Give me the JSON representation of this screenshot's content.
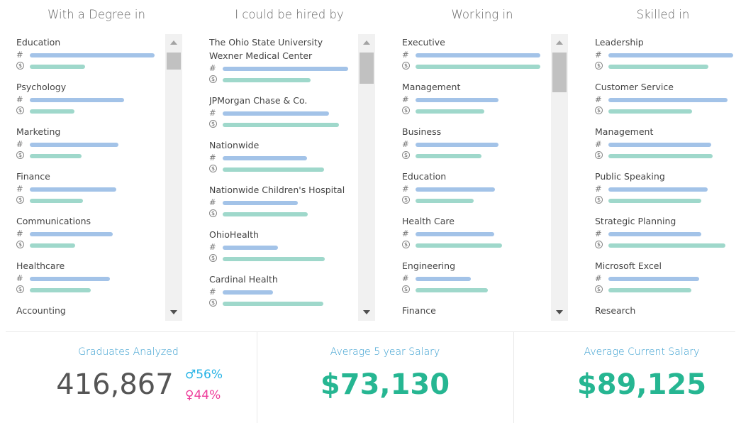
{
  "columns": [
    {
      "title": "With a Degree in",
      "items": [
        {
          "label": "Education"
        },
        {
          "label": "Psychology"
        },
        {
          "label": "Marketing"
        },
        {
          "label": "Finance"
        },
        {
          "label": "Communications"
        },
        {
          "label": "Healthcare"
        },
        {
          "label": "Accounting"
        }
      ]
    },
    {
      "title": "I could be hired by",
      "items": [
        {
          "label": "The Ohio State University",
          "label2": "Wexner Medical Center"
        },
        {
          "label": "JPMorgan Chase & Co."
        },
        {
          "label": "Nationwide"
        },
        {
          "label": "Nationwide Children's Hospital"
        },
        {
          "label": "OhioHealth"
        },
        {
          "label": "Cardinal Health"
        }
      ]
    },
    {
      "title": "Working in",
      "items": [
        {
          "label": "Executive"
        },
        {
          "label": "Management"
        },
        {
          "label": "Business"
        },
        {
          "label": "Education"
        },
        {
          "label": "Health Care"
        },
        {
          "label": "Engineering"
        },
        {
          "label": "Finance"
        }
      ]
    },
    {
      "title": "Skilled in",
      "items": [
        {
          "label": "Leadership"
        },
        {
          "label": "Customer Service"
        },
        {
          "label": "Management"
        },
        {
          "label": "Public Speaking"
        },
        {
          "label": "Strategic Planning"
        },
        {
          "label": "Microsoft Excel"
        },
        {
          "label": "Research"
        }
      ]
    }
  ],
  "metric_symbols": {
    "count": "#",
    "salary": "$"
  },
  "stats": {
    "graduates": {
      "label": "Graduates Analyzed",
      "value": "416,867",
      "male": "♂56%",
      "female": "♀44%"
    },
    "five_year": {
      "label": "Average 5 year Salary",
      "value": "$73,130"
    },
    "current": {
      "label": "Average Current Salary",
      "value": "$89,125"
    }
  },
  "colors": {
    "count_bar": "#a3c3e8",
    "salary_bar": "#9fd8cb",
    "stat_label": "#3a9fd0",
    "salary_value": "#26b692",
    "male": "#27b3e6",
    "female": "#ee3f9c"
  },
  "icons": [
    "hash-icon",
    "dollar-circle-icon",
    "scroll-up-arrow-icon",
    "scroll-down-arrow-icon"
  ]
}
